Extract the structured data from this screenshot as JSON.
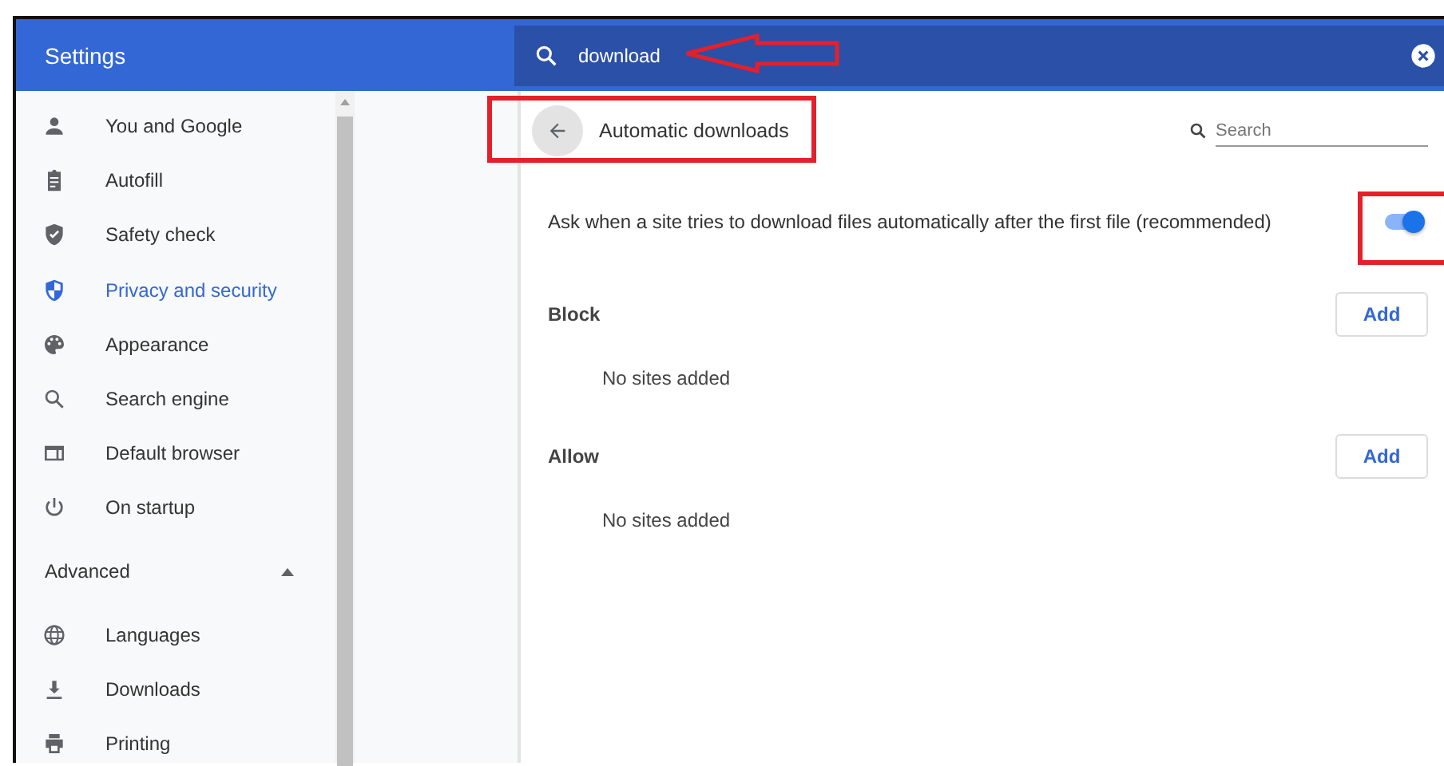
{
  "header": {
    "title": "Settings",
    "search": {
      "value": "download"
    }
  },
  "sidebar": {
    "items": [
      {
        "label": "You and Google",
        "selected": false
      },
      {
        "label": "Autofill",
        "selected": false
      },
      {
        "label": "Safety check",
        "selected": false
      },
      {
        "label": "Privacy and security",
        "selected": true
      },
      {
        "label": "Appearance",
        "selected": false
      },
      {
        "label": "Search engine",
        "selected": false
      },
      {
        "label": "Default browser",
        "selected": false
      },
      {
        "label": "On startup",
        "selected": false
      }
    ],
    "advanced": {
      "label": "Advanced",
      "expanded": true,
      "items": [
        {
          "label": "Languages",
          "selected": false
        },
        {
          "label": "Downloads",
          "selected": false
        },
        {
          "label": "Printing",
          "selected": false
        }
      ]
    }
  },
  "page": {
    "title": "Automatic downloads",
    "search": {
      "placeholder": "Search"
    },
    "setting": {
      "label": "Ask when a site tries to download files automatically after the first file (recommended)",
      "on": true
    },
    "sections": [
      {
        "title": "Block",
        "button": "Add",
        "empty_text": "No sites added"
      },
      {
        "title": "Allow",
        "button": "Add",
        "empty_text": "No sites added"
      }
    ]
  }
}
